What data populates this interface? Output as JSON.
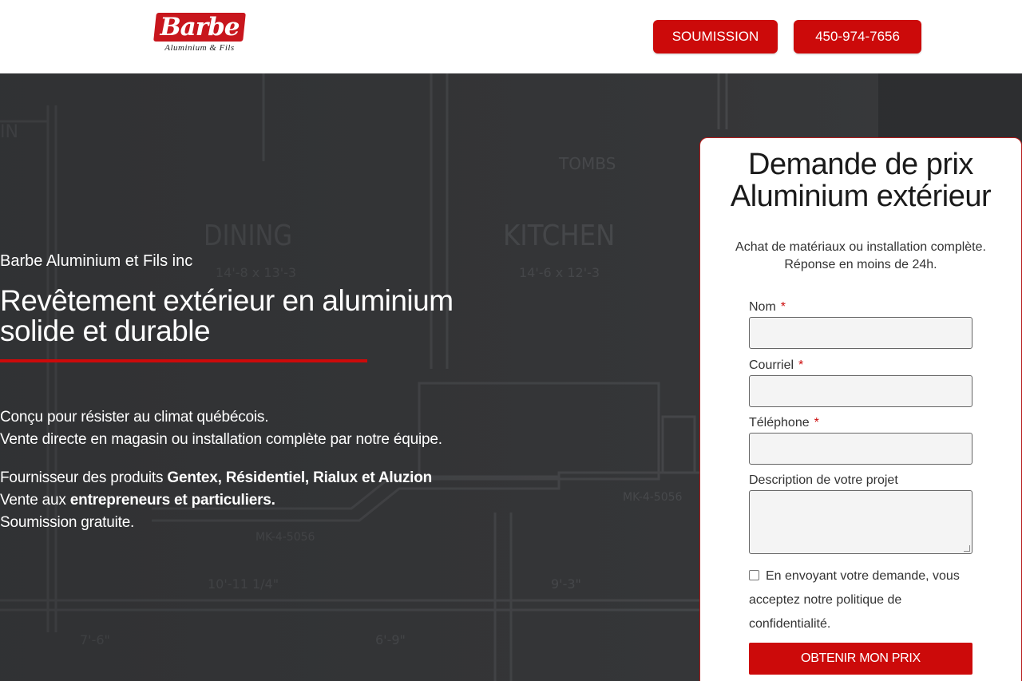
{
  "logo": {
    "word": "Barbe",
    "tagline": "Aluminium & Fils"
  },
  "header": {
    "quote_button": "SOUMISSION",
    "phone_button": "450-974-7656"
  },
  "hero": {
    "background_icon": "blueprint-floorplan-image",
    "company": "Barbe Aluminium et Fils inc",
    "headline": "Revêtement extérieur en aluminium solide et durable",
    "para1_line1": "Conçu pour résister au climat québécois.",
    "para1_line2": "Vente directe en magasin ou installation complète par notre équipe.",
    "para2_line1_a": "Fournisseur des produits ",
    "para2_line1_b": "Gentex, Résidentiel, Rialux et Aluzion",
    "para2_line2_a": "Vente aux ",
    "para2_line2_b": "entrepreneurs et particuliers.",
    "para2_line3": "Soumission gratuite."
  },
  "form": {
    "title": "Demande de prix Aluminium extérieur",
    "subtitle": "Achat de matériaux ou installation complète. Réponse en moins de 24h.",
    "required_mark": "*",
    "name_label": "Nom",
    "email_label": "Courriel",
    "phone_label": "Téléphone",
    "description_label": "Description de votre projet",
    "name_value": "",
    "email_value": "",
    "phone_value": "",
    "description_value": "",
    "consent_text": "En envoyant votre demande, vous acceptez notre politique de confidentialité.",
    "consent_checked": false,
    "submit_label": "OBTENIR MON PRIX"
  },
  "colors": {
    "brand_red": "#cc0a0a",
    "hero_background": "#3a3b3d",
    "input_background": "#f4f4f4"
  }
}
